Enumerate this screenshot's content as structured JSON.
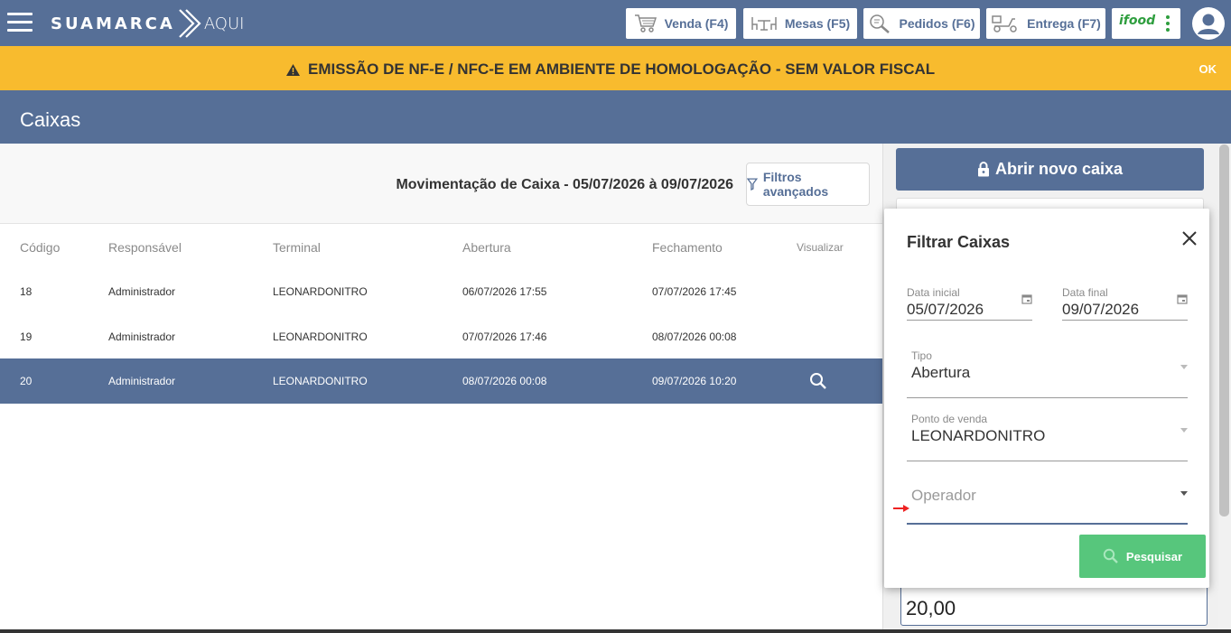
{
  "brand": {
    "name_main": "SUAMARCA",
    "name_sub": "AQUI"
  },
  "topnav": {
    "venda": "Venda (F4)",
    "mesas": "Mesas (F5)",
    "pedidos": "Pedidos (F6)",
    "entrega": "Entrega (F7)",
    "ifood": "ifood"
  },
  "warning": {
    "text": "EMISSÃO DE NF-E / NFC-E EM AMBIENTE DE HOMOLOGAÇÃO - SEM VALOR FISCAL",
    "ok": "OK"
  },
  "page": {
    "title": "Caixas"
  },
  "movimentacao": {
    "title": "Movimentação de Caixa - 05/07/2026 à 09/07/2026",
    "filters_button": "Filtros avançados"
  },
  "table": {
    "headers": {
      "codigo": "Código",
      "responsavel": "Responsável",
      "terminal": "Terminal",
      "abertura": "Abertura",
      "fechamento": "Fechamento",
      "visualizar": "Visualizar"
    },
    "rows": [
      {
        "codigo": "18",
        "responsavel": "Administrador",
        "terminal": "LEONARDONITRO",
        "abertura": "06/07/2026 17:55",
        "fechamento": "07/07/2026 17:45"
      },
      {
        "codigo": "19",
        "responsavel": "Administrador",
        "terminal": "LEONARDONITRO",
        "abertura": "07/07/2026 17:46",
        "fechamento": "08/07/2026 00:08"
      },
      {
        "codigo": "20",
        "responsavel": "Administrador",
        "terminal": "LEONARDONITRO",
        "abertura": "08/07/2026 00:08",
        "fechamento": "09/07/2026 10:20"
      }
    ]
  },
  "sidepanel": {
    "abrir_button": "Abrir novo caixa",
    "value": "20,00"
  },
  "filter_popup": {
    "title": "Filtrar Caixas",
    "data_inicial_label": "Data inicial",
    "data_inicial_value": "05/07/2026",
    "data_final_label": "Data final",
    "data_final_value": "09/07/2026",
    "tipo_label": "Tipo",
    "tipo_value": "Abertura",
    "ponto_label": "Ponto de venda",
    "ponto_value": "LEONARDONITRO",
    "operador_placeholder": "Operador",
    "pesquisar_button": "Pesquisar"
  },
  "colors": {
    "primary": "#566f97",
    "warning": "#f8bb2e",
    "success": "#57c67c",
    "ifood_green": "#2e9e3e"
  }
}
